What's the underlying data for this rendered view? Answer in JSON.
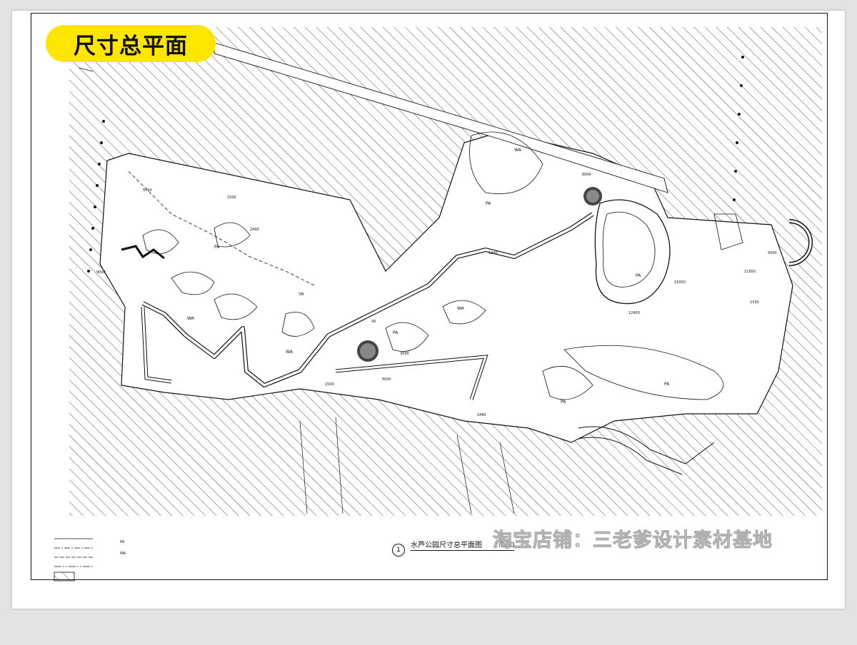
{
  "title_badge": "尺寸总平面",
  "drawing": {
    "caption": "水芦公园尺寸总平面图",
    "scale": "1:500",
    "number": "1"
  },
  "watermark": "淘宝店铺：三老爹设计素材基地",
  "zone_labels": [
    "PA",
    "WA",
    "YA"
  ],
  "dimension_labels": [
    "9000",
    "5000",
    "1500",
    "2400",
    "3000",
    "12400",
    "15000",
    "1500",
    "8000",
    "5000",
    "1200",
    "2330",
    "11950",
    "5000",
    "2480",
    "40"
  ],
  "legend": {
    "abbr_pa": "PA",
    "abbr_wa": "WA"
  },
  "colors": {
    "badge": "#ffe600",
    "line": "#111111",
    "sheet": "#ffffff",
    "background": "#e3e3e3"
  }
}
